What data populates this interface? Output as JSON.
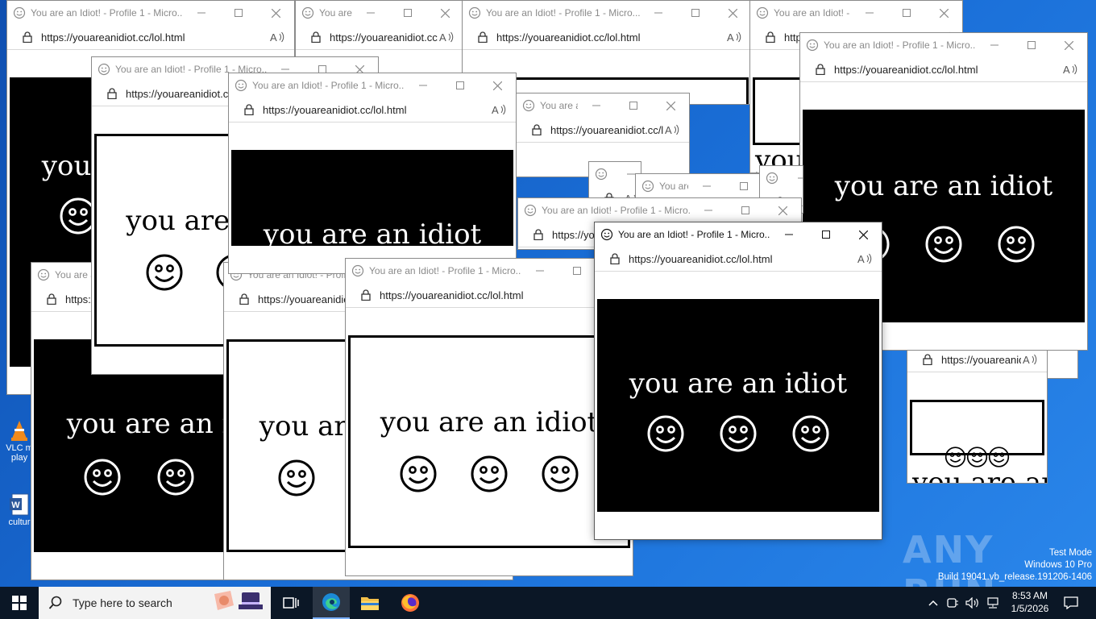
{
  "desktop": {
    "icons": [
      {
        "label": "VLC media player",
        "label_visible": "VLC m\nplay"
      },
      {
        "label": "culture",
        "label_visible": "cultur"
      }
    ],
    "watermark": "ANY RUN",
    "test_mode": {
      "line1": "Test Mode",
      "line2": "Windows 10 Pro",
      "line3": "Build 19041.vb_release.191206-1406"
    }
  },
  "browser": {
    "window_title": "You are an Idiot! - Profile 1 - Micro...",
    "url": "https://youareanidiot.cc/lol.html",
    "page_text": "you are an idiot",
    "controls": {
      "minimize": "minimize",
      "maximize": "maximize",
      "close": "close"
    }
  },
  "taskbar": {
    "search_placeholder": "Type here to search",
    "apps": [
      "task-view",
      "edge",
      "file-explorer",
      "firefox"
    ],
    "time": "8:53 AM",
    "date": "1/5/2026"
  },
  "colors": {
    "taskbar": "#0b1726",
    "desktop": "#1a6fd8",
    "panel_black": "#000000",
    "panel_white": "#ffffff"
  }
}
